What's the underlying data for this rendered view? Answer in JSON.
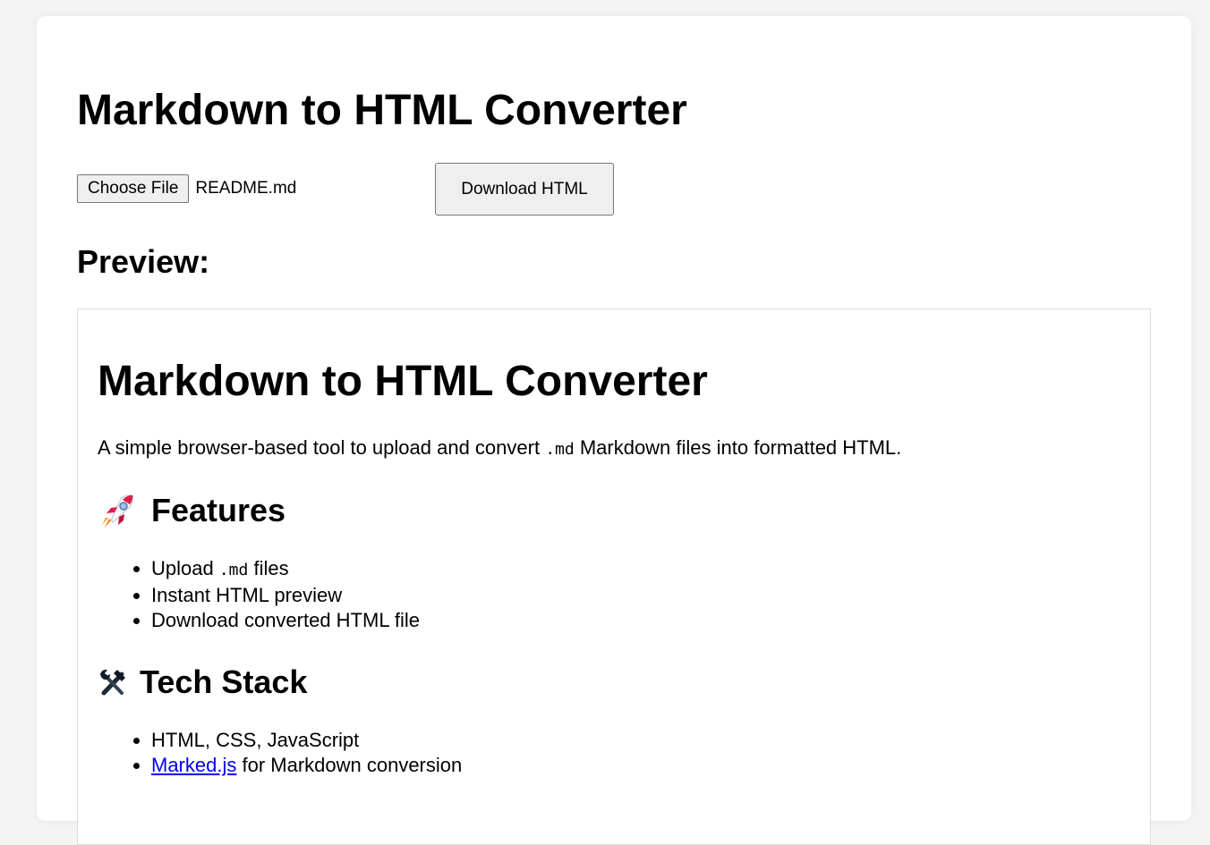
{
  "app": {
    "title": "Markdown to HTML Converter"
  },
  "file_input": {
    "button_label": "Choose File",
    "file_name": "README.md"
  },
  "download": {
    "label": "Download HTML"
  },
  "preview": {
    "heading": "Preview:",
    "h1": "Markdown to HTML Converter",
    "intro": {
      "before": "A simple browser-based tool to upload and convert ",
      "code": ".md",
      "after": " Markdown files into formatted HTML."
    },
    "features": {
      "icon": "rocket-icon",
      "heading": "Features",
      "items": [
        {
          "before": "Upload ",
          "code": ".md",
          "after": " files"
        },
        {
          "text": "Instant HTML preview"
        },
        {
          "text": "Download converted HTML file"
        }
      ]
    },
    "tech_stack": {
      "icon": "hammer-and-wrench-icon",
      "heading": "Tech Stack",
      "items": [
        {
          "text": "HTML, CSS, JavaScript"
        },
        {
          "link": "Marked.js",
          "after": " for Markdown conversion"
        }
      ]
    }
  },
  "colors": {
    "page_background": "#f4f4f4",
    "card_background": "#ffffff",
    "link": "#0000ee",
    "button_background": "#efefef"
  }
}
